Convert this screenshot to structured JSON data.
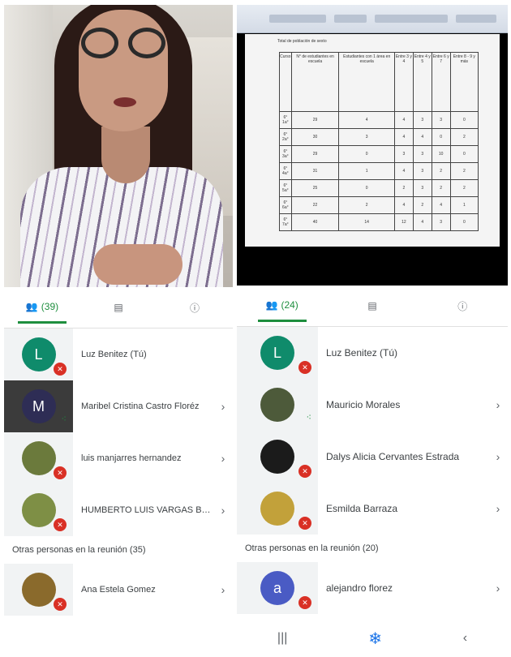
{
  "left": {
    "participants_count": "(39)",
    "participants": [
      {
        "initial": "L",
        "name": "Luz Benitez (Tú)",
        "avatar_color": "#0f8b6b",
        "status": "muted",
        "chevron": ""
      },
      {
        "initial": "M",
        "name": "Maribel Cristina Castro Floréz",
        "avatar_color": "#2e2d55",
        "status": "speaking",
        "chevron": "›"
      },
      {
        "initial": "",
        "name": "luis manjarres hernandez",
        "avatar_color": "#6b7a3c",
        "status": "muted",
        "chevron": "›"
      },
      {
        "initial": "",
        "name": "HUMBERTO LUIS VARGAS BO...",
        "avatar_color": "#7e8f45",
        "status": "muted",
        "chevron": "›"
      }
    ],
    "others_label": "Otras personas en la reunión (35)",
    "others": [
      {
        "initial": "",
        "name": "Ana Estela Gomez",
        "avatar_color": "#8a6a2c",
        "status": "muted",
        "chevron": "›"
      }
    ]
  },
  "right": {
    "participants_count": "(24)",
    "doc": {
      "title": "Total de población de sexto",
      "headers": [
        "Curso",
        "N° de estudiantes en escuela",
        "Estudiantes con 1 área en escuela",
        "Entre 3 y 4",
        "Entre 4 y 5",
        "Entre 6 y 7",
        "Entre 8 - 9 y más"
      ],
      "rows": [
        [
          "6° 1a°",
          "29",
          "4",
          "4",
          "3",
          "3",
          "0"
        ],
        [
          "6° 2a°",
          "30",
          "3",
          "4",
          "4",
          "0",
          "2"
        ],
        [
          "6° 3a°",
          "29",
          "0",
          "3",
          "3",
          "10",
          "0"
        ],
        [
          "6° 4a°",
          "31",
          "1",
          "4",
          "3",
          "2",
          "2"
        ],
        [
          "6° 5a°",
          "25",
          "0",
          "2",
          "3",
          "2",
          "2"
        ],
        [
          "6° 6a°",
          "22",
          "2",
          "4",
          "2",
          "4",
          "1"
        ],
        [
          "6° 7a°",
          "40",
          "14",
          "12",
          "4",
          "3",
          "0"
        ]
      ]
    },
    "participants": [
      {
        "initial": "L",
        "name": "Luz Benitez (Tú)",
        "avatar_color": "#0f8b6b",
        "status": "muted",
        "chevron": ""
      },
      {
        "initial": "",
        "name": "Mauricio Morales",
        "avatar_color": "#4d5a3a",
        "status": "speaking",
        "chevron": "›"
      },
      {
        "initial": "",
        "name": "Dalys Alicia Cervantes Estrada",
        "avatar_color": "#1b1b1b",
        "status": "muted",
        "chevron": "›"
      },
      {
        "initial": "",
        "name": "Esmilda Barraza",
        "avatar_color": "#c2a13a",
        "status": "muted",
        "chevron": "›"
      }
    ],
    "others_label": "Otras personas en la reunión (20)",
    "others": [
      {
        "initial": "a",
        "name": "alejandro florez",
        "avatar_color": "#4a5bc4",
        "status": "muted",
        "chevron": "›"
      }
    ]
  }
}
